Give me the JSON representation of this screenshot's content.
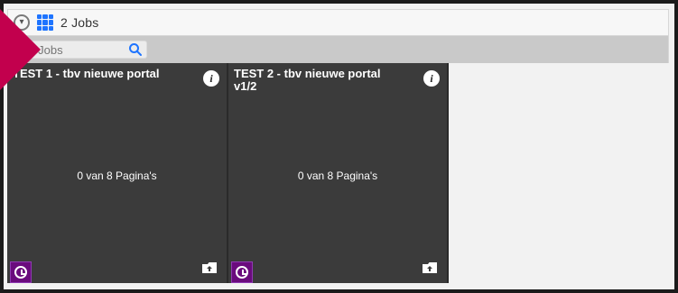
{
  "header": {
    "jobs_count_label": "2 Jobs",
    "icons": {
      "collapse": "chevron-down-icon",
      "grid": "grid-icon"
    }
  },
  "search": {
    "placeholder": "k Jobs",
    "icon": "search-icon"
  },
  "jobs": [
    {
      "title": "TEST 1 - tbv nieuwe portal",
      "pages_label": "0 van 8 Pagina's",
      "icons": {
        "info": "info-icon",
        "clock": "clock-icon",
        "upload": "folder-upload-icon"
      }
    },
    {
      "title": "TEST 2 - tbv nieuwe portal v1/2",
      "pages_label": "0 van 8 Pagina's",
      "icons": {
        "info": "info-icon",
        "clock": "clock-icon",
        "upload": "folder-upload-icon"
      }
    }
  ],
  "colors": {
    "accent_blue": "#1e74ff",
    "card_bg": "#3b3b3b",
    "clock_bg": "#6a0b7d",
    "triangle": "#c2004d"
  }
}
